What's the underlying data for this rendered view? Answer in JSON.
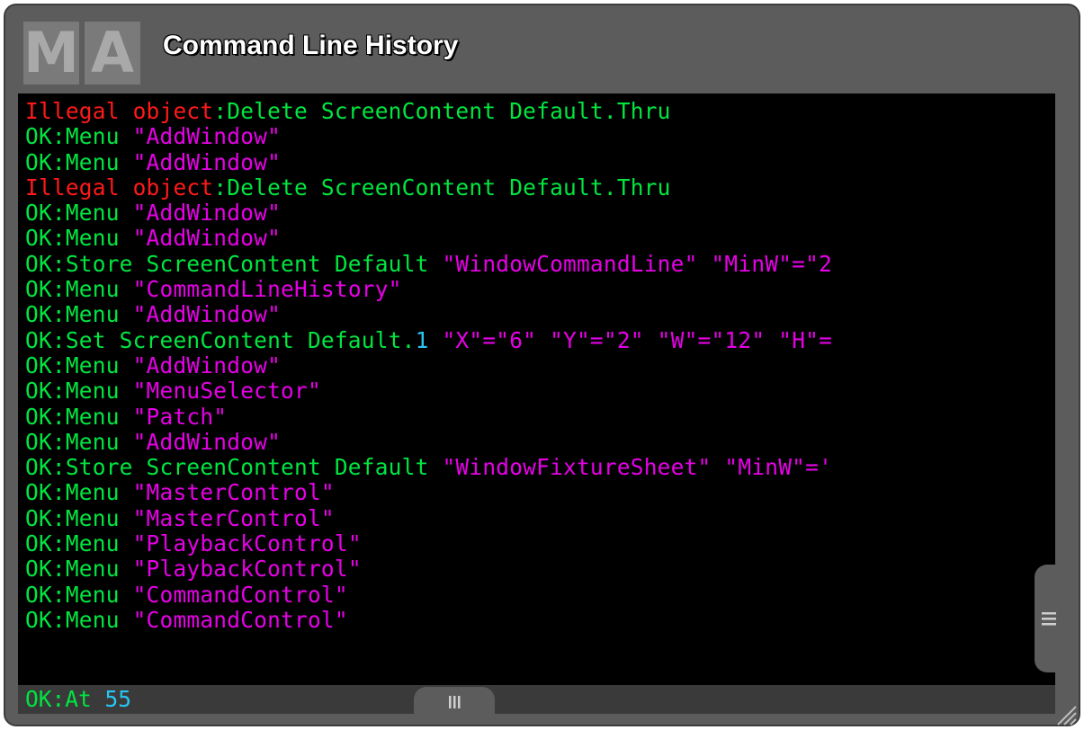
{
  "window": {
    "logo_letters": [
      "M",
      "A"
    ],
    "title": "Command Line History"
  },
  "history": [
    [
      {
        "t": "Illegal object",
        "c": "red"
      },
      {
        "t": ":Delete ScreenContent Default.Thru",
        "c": "green"
      }
    ],
    [
      {
        "t": "OK",
        "c": "green"
      },
      {
        "t": ":Menu ",
        "c": "green"
      },
      {
        "t": "\"AddWindow\"",
        "c": "magenta"
      }
    ],
    [
      {
        "t": "OK",
        "c": "green"
      },
      {
        "t": ":Menu ",
        "c": "green"
      },
      {
        "t": "\"AddWindow\"",
        "c": "magenta"
      }
    ],
    [
      {
        "t": "Illegal object",
        "c": "red"
      },
      {
        "t": ":Delete ScreenContent Default.Thru",
        "c": "green"
      }
    ],
    [
      {
        "t": "OK",
        "c": "green"
      },
      {
        "t": ":Menu ",
        "c": "green"
      },
      {
        "t": "\"AddWindow\"",
        "c": "magenta"
      }
    ],
    [
      {
        "t": "OK",
        "c": "green"
      },
      {
        "t": ":Menu ",
        "c": "green"
      },
      {
        "t": "\"AddWindow\"",
        "c": "magenta"
      }
    ],
    [
      {
        "t": "OK",
        "c": "green"
      },
      {
        "t": ":Store ScreenContent Default ",
        "c": "green"
      },
      {
        "t": "\"WindowCommandLine\" \"MinW\"=\"2",
        "c": "magenta"
      }
    ],
    [
      {
        "t": "OK",
        "c": "green"
      },
      {
        "t": ":Menu ",
        "c": "green"
      },
      {
        "t": "\"CommandLineHistory\"",
        "c": "magenta"
      }
    ],
    [
      {
        "t": "OK",
        "c": "green"
      },
      {
        "t": ":Menu ",
        "c": "green"
      },
      {
        "t": "\"AddWindow\"",
        "c": "magenta"
      }
    ],
    [
      {
        "t": "OK",
        "c": "green"
      },
      {
        "t": ":Set ScreenContent Default.",
        "c": "green"
      },
      {
        "t": "1",
        "c": "cyan"
      },
      {
        "t": " \"X\"=\"6\" \"Y\"=\"2\" \"W\"=\"12\" \"H\"=",
        "c": "magenta"
      }
    ],
    [
      {
        "t": "OK",
        "c": "green"
      },
      {
        "t": ":Menu ",
        "c": "green"
      },
      {
        "t": "\"AddWindow\"",
        "c": "magenta"
      }
    ],
    [
      {
        "t": "OK",
        "c": "green"
      },
      {
        "t": ":Menu ",
        "c": "green"
      },
      {
        "t": "\"MenuSelector\"",
        "c": "magenta"
      }
    ],
    [
      {
        "t": "OK",
        "c": "green"
      },
      {
        "t": ":Menu ",
        "c": "green"
      },
      {
        "t": "\"Patch\"",
        "c": "magenta"
      }
    ],
    [
      {
        "t": "OK",
        "c": "green"
      },
      {
        "t": ":Menu ",
        "c": "green"
      },
      {
        "t": "\"AddWindow\"",
        "c": "magenta"
      }
    ],
    [
      {
        "t": "OK",
        "c": "green"
      },
      {
        "t": ":Store ScreenContent Default ",
        "c": "green"
      },
      {
        "t": "\"WindowFixtureSheet\" \"MinW\"='",
        "c": "magenta"
      }
    ],
    [
      {
        "t": "OK",
        "c": "green"
      },
      {
        "t": ":Menu ",
        "c": "green"
      },
      {
        "t": "\"MasterControl\"",
        "c": "magenta"
      }
    ],
    [
      {
        "t": "OK",
        "c": "green"
      },
      {
        "t": ":Menu ",
        "c": "green"
      },
      {
        "t": "\"MasterControl\"",
        "c": "magenta"
      }
    ],
    [
      {
        "t": "OK",
        "c": "green"
      },
      {
        "t": ":Menu ",
        "c": "green"
      },
      {
        "t": "\"PlaybackControl\"",
        "c": "magenta"
      }
    ],
    [
      {
        "t": "OK",
        "c": "green"
      },
      {
        "t": ":Menu ",
        "c": "green"
      },
      {
        "t": "\"PlaybackControl\"",
        "c": "magenta"
      }
    ],
    [
      {
        "t": "OK",
        "c": "green"
      },
      {
        "t": ":Menu ",
        "c": "green"
      },
      {
        "t": "\"CommandControl\"",
        "c": "magenta"
      }
    ],
    [
      {
        "t": "OK",
        "c": "green"
      },
      {
        "t": ":Menu ",
        "c": "green"
      },
      {
        "t": "\"CommandControl\"",
        "c": "magenta"
      }
    ]
  ],
  "current_line": [
    {
      "t": "OK:At ",
      "c": "green"
    },
    {
      "t": "55",
      "c": "cyan"
    }
  ],
  "colors": {
    "red": "#ff1a1a",
    "green": "#00e640",
    "magenta": "#e600e6",
    "cyan": "#26c6f2",
    "window_bg": "#5c5c5c",
    "console_bg": "#000000"
  },
  "icons": {
    "bottom_resize": "grip-vertical-lines-icon",
    "side_resize": "grip-horizontal-lines-icon",
    "corner_resize": "resize-corner-icon"
  }
}
